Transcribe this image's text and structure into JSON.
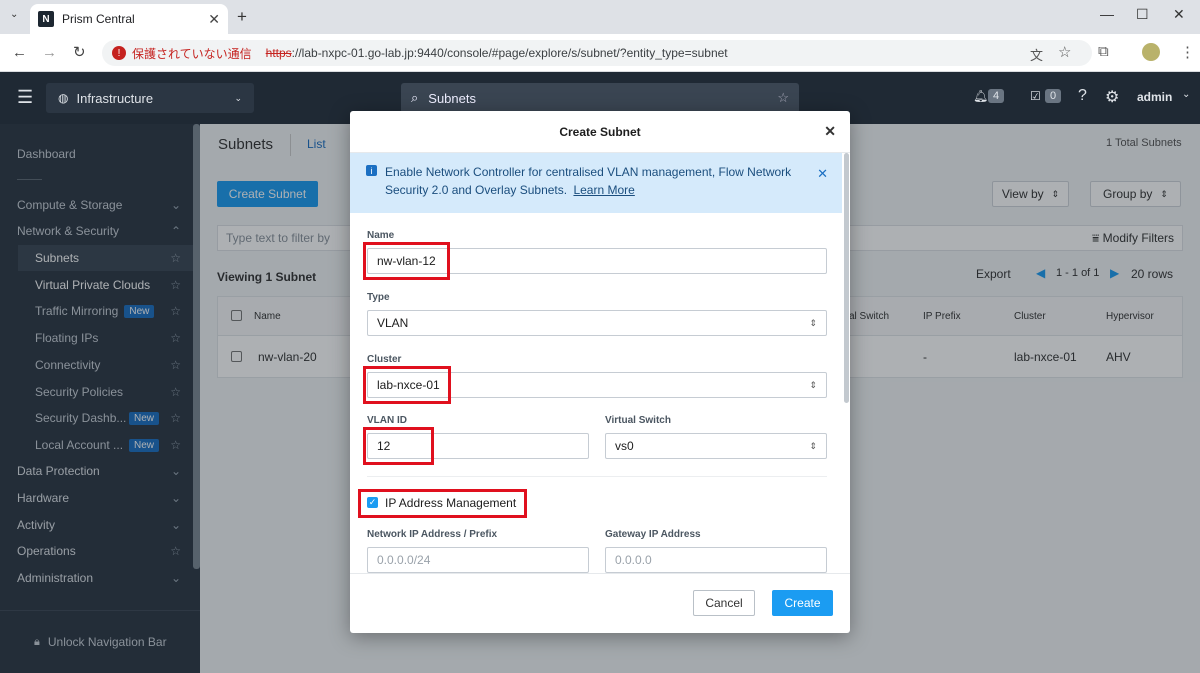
{
  "browser": {
    "tab_title": "Prism Central",
    "tab_favicon": "N",
    "security_warning": "保護されていない通信",
    "url_protocol": "https",
    "url_rest": "://lab-nxpc-01.go-lab.jp:9440/console/#page/explore/s/subnet/?entity_type=subnet"
  },
  "app_header": {
    "context": "Infrastructure",
    "search_value": "Subnets",
    "alerts_count": "4",
    "tasks_count": "0",
    "user": "admin"
  },
  "sidebar": {
    "dashboard": "Dashboard",
    "sections": [
      {
        "label": "Compute & Storage"
      },
      {
        "label": "Network & Security"
      }
    ],
    "items": [
      {
        "label": "Subnets",
        "badge": ""
      },
      {
        "label": "Virtual Private Clouds",
        "badge": ""
      },
      {
        "label": "Traffic Mirroring",
        "badge": "New"
      },
      {
        "label": "Floating IPs",
        "badge": ""
      },
      {
        "label": "Connectivity",
        "badge": ""
      },
      {
        "label": "Security Policies",
        "badge": ""
      },
      {
        "label": "Security Dashb...",
        "badge": "New"
      },
      {
        "label": "Local Account ...",
        "badge": "New"
      }
    ],
    "bottom_sections": [
      {
        "label": "Data Protection"
      },
      {
        "label": "Hardware"
      },
      {
        "label": "Activity"
      },
      {
        "label": "Operations"
      },
      {
        "label": "Administration"
      }
    ],
    "unlock": "Unlock Navigation Bar"
  },
  "main": {
    "title": "Subnets",
    "tab_list": "List",
    "total": "1 Total Subnets",
    "create_button": "Create Subnet",
    "view_by": "View by",
    "group_by": "Group by",
    "filter_placeholder": "Type text to filter by",
    "modify_filters": "Modify Filters",
    "viewing": "Viewing 1 Subnet",
    "export": "Export",
    "pager": "1 - 1 of 1",
    "rows": "20 rows",
    "columns": [
      "Name",
      "al Switch",
      "IP Prefix",
      "Cluster",
      "Hypervisor"
    ],
    "row": {
      "name": "nw-vlan-20",
      "ip_prefix": "-",
      "cluster": "lab-nxce-01",
      "hypervisor": "AHV"
    }
  },
  "modal": {
    "title": "Create Subnet",
    "info_text": "Enable Network Controller for centralised VLAN management, Flow Network Security 2.0 and Overlay Subnets.",
    "learn_more": "Learn More",
    "name_label": "Name",
    "name_value": "nw-vlan-12",
    "type_label": "Type",
    "type_value": "VLAN",
    "cluster_label": "Cluster",
    "cluster_value": "lab-nxce-01",
    "vlan_label": "VLAN ID",
    "vlan_value": "12",
    "vswitch_label": "Virtual Switch",
    "vswitch_value": "vs0",
    "ipam_label": "IP Address Management",
    "ipam_checked": true,
    "net_label": "Network IP Address / Prefix",
    "net_placeholder": "0.0.0.0/24",
    "gw_label": "Gateway IP Address",
    "gw_placeholder": "0.0.0.0",
    "cancel": "Cancel",
    "create": "Create"
  },
  "colors": {
    "accent": "#1b9cf2",
    "highlight": "#e0101e",
    "sidebar_bg": "#2b3643"
  }
}
